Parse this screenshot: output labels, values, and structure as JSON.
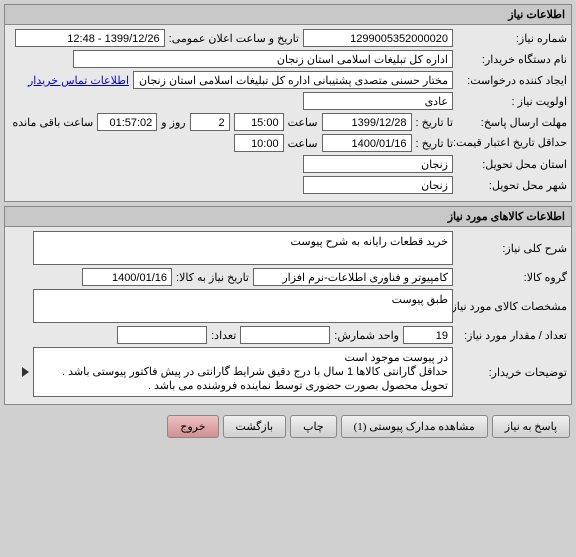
{
  "panel1": {
    "title": "اطلاعات نیاز",
    "rows": {
      "req_no_label": "شماره نیاز:",
      "req_no": "1299005352000020",
      "announce_label": "تاریخ و ساعت اعلان عمومی:",
      "announce_value": "1399/12/26 - 12:48",
      "buyer_org_label": "نام دستگاه خریدار:",
      "buyer_org": "اداره کل تبلیغات اسلامی استان زنجان",
      "creator_label": "ایجاد کننده درخواست:",
      "creator": "مختار حسنی متصدی پشتیبانی  اداره کل تبلیغات اسلامی استان زنجان",
      "contact_link": "اطلاعات تماس خریدار",
      "priority_label": "اولویت نیاز :",
      "priority": "عادی",
      "deadline_label": "مهلت ارسال پاسخ:",
      "until_label": "تا تاریخ :",
      "deadline_date": "1399/12/28",
      "time_label": "ساعت",
      "deadline_time": "15:00",
      "days_remain": "2",
      "days_label": "روز و",
      "time_remain": "01:57:02",
      "remain_label": "ساعت باقی مانده",
      "min_valid_label": "حداقل تاریخ اعتبار قیمت:",
      "min_valid_until": "تا تاریخ :",
      "min_valid_date": "1400/01/16",
      "min_valid_time": "10:00",
      "province_label": "استان محل تحویل:",
      "province": "زنجان",
      "city_label": "شهر محل تحویل:",
      "city": "زنجان"
    }
  },
  "panel2": {
    "title": "اطلاعات کالاهای مورد نیاز",
    "rows": {
      "desc_label": "شرح کلی نیاز:",
      "desc": "خرید قطعات رایانه به شرح پیوست",
      "group_label": "گروه کالا:",
      "group": "کامپیوتر و فناوری اطلاعات-نرم افزار",
      "need_date_label": "تاریخ نیاز به کالا:",
      "need_date": "1400/01/16",
      "spec_label": "مشخصات کالای مورد نیاز:",
      "spec": "طبق پیوست",
      "qty_label": "تعداد / مقدار مورد نیاز:",
      "qty": "19",
      "unit_label": "واحد شمارش:",
      "unit": "",
      "count_label": "تعداد:",
      "count": "",
      "notes_label": "توضیحات خریدار:",
      "notes": "در پیوست موجود است\nحداقل گارانتی کالاها  1 سال با درج دقیق شرایط گارانتی در پیش فاکتور پیوستی باشد .\nتحویل محصول بصورت حضوری توسط نماینده فروشنده  می باشد ."
    }
  },
  "buttons": {
    "respond": "پاسخ به نیاز",
    "attachments": "مشاهده مدارک پیوستی (1)",
    "print": "چاپ",
    "back": "بازگشت",
    "exit": "خروج"
  }
}
